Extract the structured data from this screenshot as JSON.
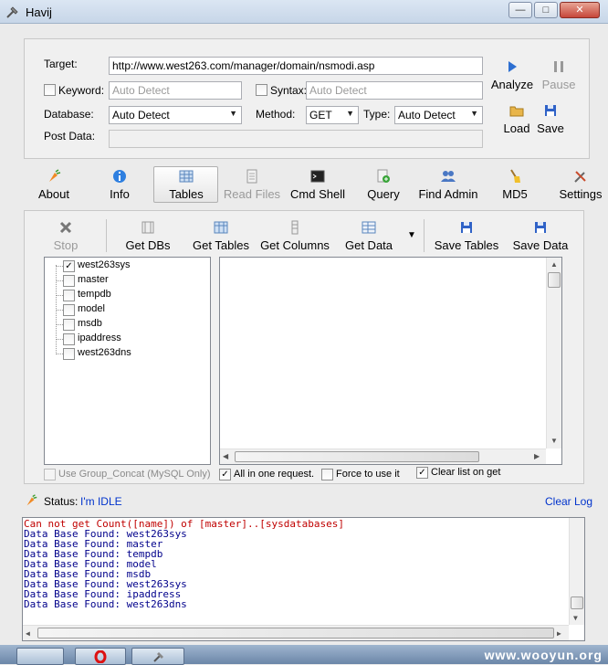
{
  "window": {
    "title": "Havij"
  },
  "form": {
    "target_label": "Target:",
    "target_value": "http://www.west263.com/manager/domain/nsmodi.asp",
    "keyword_label": "Keyword:",
    "keyword_placeholder": "Auto Detect",
    "syntax_label": "Syntax:",
    "syntax_placeholder": "Auto Detect",
    "database_label": "Database:",
    "database_value": "Auto Detect",
    "method_label": "Method:",
    "method_value": "GET",
    "type_label": "Type:",
    "type_value": "Auto Detect",
    "postdata_label": "Post Data:"
  },
  "actions": {
    "analyze": "Analyze",
    "pause": "Pause",
    "load": "Load",
    "save": "Save"
  },
  "tabs": [
    {
      "label": "About"
    },
    {
      "label": "Info"
    },
    {
      "label": "Tables"
    },
    {
      "label": "Read Files"
    },
    {
      "label": "Cmd Shell"
    },
    {
      "label": "Query"
    },
    {
      "label": "Find Admin"
    },
    {
      "label": "MD5"
    },
    {
      "label": "Settings"
    }
  ],
  "toolbar": {
    "stop": "Stop",
    "get_dbs": "Get DBs",
    "get_tables": "Get Tables",
    "get_columns": "Get Columns",
    "get_data": "Get Data",
    "save_tables": "Save Tables",
    "save_data": "Save Data"
  },
  "tree": {
    "items": [
      {
        "label": "west263sys",
        "checked": true
      },
      {
        "label": "master",
        "checked": false
      },
      {
        "label": "tempdb",
        "checked": false
      },
      {
        "label": "model",
        "checked": false
      },
      {
        "label": "msdb",
        "checked": false
      },
      {
        "label": "ipaddress",
        "checked": false
      },
      {
        "label": "west263dns",
        "checked": false
      }
    ]
  },
  "options": {
    "group_concat": "Use Group_Concat (MySQL Only)",
    "all_in_one": "All in one request.",
    "force": "Force to use it",
    "clear_list": "Clear list on get"
  },
  "status": {
    "label": "Status:",
    "value": "I'm IDLE",
    "clear_log": "Clear Log"
  },
  "log": {
    "lines": [
      {
        "text": "Can not get Count([name]) of [master]..[sysdatabases]",
        "color": "#c00000"
      },
      {
        "text": "Data Base Found: west263sys",
        "color": "#00008b"
      },
      {
        "text": "Data Base Found: master",
        "color": "#00008b"
      },
      {
        "text": "Data Base Found: tempdb",
        "color": "#00008b"
      },
      {
        "text": "Data Base Found: model",
        "color": "#00008b"
      },
      {
        "text": "Data Base Found: msdb",
        "color": "#00008b"
      },
      {
        "text": "Data Base Found: west263sys",
        "color": "#00008b"
      },
      {
        "text": "Data Base Found: ipaddress",
        "color": "#00008b"
      },
      {
        "text": "Data Base Found: west263dns",
        "color": "#00008b"
      }
    ]
  },
  "watermark": "www.wooyun.org"
}
